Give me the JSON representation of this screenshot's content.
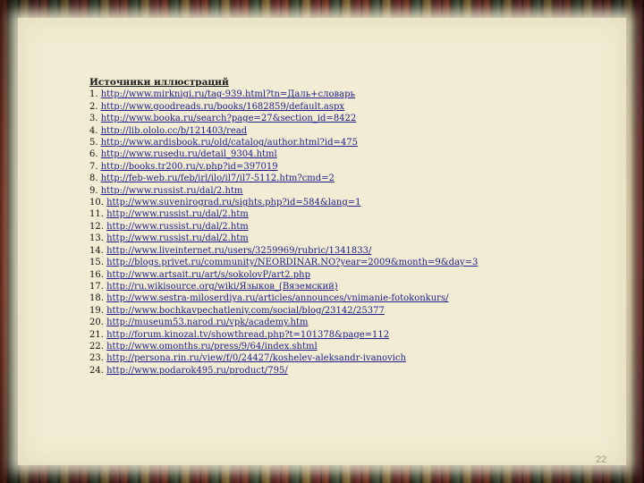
{
  "heading": "Источники иллюстраций",
  "sources": [
    {
      "num": "1.",
      "url": "http://www.mirknigi.ru/tag-939.html?tn=Даль+словарь"
    },
    {
      "num": "2.",
      "url": "http://www.goodreads.ru/books/1682859/default.aspx"
    },
    {
      "num": "3.",
      "url": "http://www.booka.ru/search?page=27&section_id=8422"
    },
    {
      "num": "4.",
      "url": "http://lib.ololo.cc/b/121403/read"
    },
    {
      "num": "5.",
      "url": "http://www.ardisbook.ru/old/catalog/author.html?id=475"
    },
    {
      "num": "6.",
      "url": "http://www.rusedu.ru/detail_9304.html"
    },
    {
      "num": "7.",
      "url": "http://books.tr200.ru/v.php?id=397019"
    },
    {
      "num": "8.",
      "url": "http://feb-web.ru/feb/irl/ilo/il7/il7-5112.htm?cmd=2"
    },
    {
      "num": "9.",
      "url": "http://www.russist.ru/dal/2.htm"
    },
    {
      "num": "10.",
      "url": "http://www.suvenirograd.ru/sights.php?id=584&lang=1"
    },
    {
      "num": "11.",
      "url": "http://www.russist.ru/dal/2.htm"
    },
    {
      "num": "12.",
      "url": "http://www.russist.ru/dal/2.htm"
    },
    {
      "num": "13.",
      "url": "http://www.russist.ru/dal/2.htm"
    },
    {
      "num": "14.",
      "url": "http://www.liveinternet.ru/users/3259969/rubric/1341833/"
    },
    {
      "num": "15.",
      "url": "http://blogs.privet.ru/community/NEORDINAR.NO?year=2009&month=9&day=3"
    },
    {
      "num": "16.",
      "url": "http://www.artsait.ru/art/s/sokolovP/art2.php"
    },
    {
      "num": "17.",
      "url": "http://ru.wikisource.org/wiki/Языков_(Вяземский)"
    },
    {
      "num": "18.",
      "url": "http://www.sestra-miloserdiya.ru/articles/announces/vnimanie-fotokonkurs/"
    },
    {
      "num": "19.",
      "url": "http://www.bochkavpechatleniy.com/social/blog/23142/25377"
    },
    {
      "num": "20.",
      "url": "http://museum53.narod.ru/vpk/academy.htm"
    },
    {
      "num": "21.",
      "url": "http://forum.kinozal.tv/showthread.php?t=101378&page=112"
    },
    {
      "num": "22.",
      "url": "http://www.omonths.ru/press/9/64/index.shtml"
    },
    {
      "num": "23.",
      "url": "http://persona.rin.ru/view/f/0/24427/koshelev-aleksandr-ivanovich"
    },
    {
      "num": "24.",
      "url": "http://www.podarok495.ru/product/795/"
    }
  ],
  "slide_number": "22"
}
